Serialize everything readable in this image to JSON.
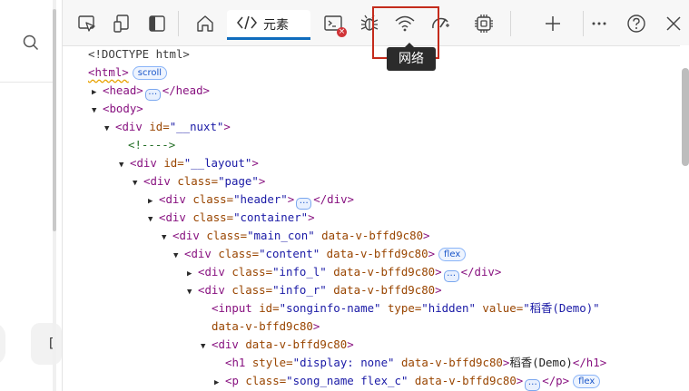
{
  "toolbar": {
    "elements_tab_label": "元素",
    "console_badge": "×",
    "network_tooltip": "网络",
    "icons": [
      "inspect-icon",
      "device-emulation-icon",
      "sidebar-toggle-icon",
      "home-icon",
      "elements-code-icon",
      "console-icon",
      "sources-bug-icon",
      "network-wifi-icon",
      "performance-icon",
      "memory-chip-icon",
      "add-tool-icon",
      "more-icon",
      "help-icon",
      "close-icon"
    ]
  },
  "left_pane": {
    "bracket": "["
  },
  "tree": {
    "doctype": "<!DOCTYPE html>",
    "html_open": "<html>",
    "html_pill": "scroll",
    "head_open": "<head>",
    "head_close": "</head>",
    "body_open": "<body>",
    "nuxt_tag": "<div ",
    "nuxt_attr": "id=",
    "nuxt_val": "\"__nuxt\"",
    "nuxt_end": ">",
    "comment": "<!---->",
    "layout_tag": "<div ",
    "layout_attr": "id=",
    "layout_val": "\"__layout\"",
    "layout_end": ">",
    "page_tag": "<div ",
    "page_attr": "class=",
    "page_val": "\"page\"",
    "page_end": ">",
    "header_tag": "<div ",
    "header_attr": "class=",
    "header_val": "\"header\"",
    "header_end": ">",
    "header_close": "</div>",
    "container_tag": "<div ",
    "container_attr": "class=",
    "container_val": "\"container\"",
    "container_end": ">",
    "maincon_tag": "<div ",
    "maincon_attr1": "class=",
    "maincon_val1": "\"main_con\"",
    "maincon_attr2": " data-v-bffd9c80",
    "maincon_end": ">",
    "content_tag": "<div ",
    "content_attr1": "class=",
    "content_val1": "\"content\"",
    "content_attr2": " data-v-bffd9c80",
    "content_end": ">",
    "content_pill": "flex",
    "infol_tag": "<div ",
    "infol_attr1": "class=",
    "infol_val1": "\"info_l\"",
    "infol_attr2": " data-v-bffd9c80",
    "infol_end": ">",
    "infol_close": "</div>",
    "infor_tag": "<div ",
    "infor_attr1": "class=",
    "infor_val1": "\"info_r\"",
    "infor_attr2": " data-v-bffd9c80",
    "infor_end": ">",
    "input_tag": "<input ",
    "input_attr1": "id=",
    "input_val1": "\"songinfo-name\"",
    "input_attr2": " type=",
    "input_val2": "\"hidden\"",
    "input_attr3": " value=",
    "input_val3": "\"稻香(Demo)\"",
    "input_cont": "data-v-bffd9c80",
    "input_end": ">",
    "dv_tag": "<div ",
    "dv_attr": "data-v-bffd9c80",
    "dv_end": ">",
    "h1_tag": "<h1 ",
    "h1_attr1": "style=",
    "h1_val1": "\"display: none\"",
    "h1_attr2": " data-v-bffd9c80",
    "h1_end": ">",
    "h1_text": "稻香(Demo)",
    "h1_close": "</h1>",
    "p_tag": "<p ",
    "p_attr1": "class=",
    "p_val1": "\"song_name flex_c\"",
    "p_attr2": " data-v-bffd9c80",
    "p_end": ">",
    "p_close": "</p>",
    "p_pill": "flex"
  }
}
